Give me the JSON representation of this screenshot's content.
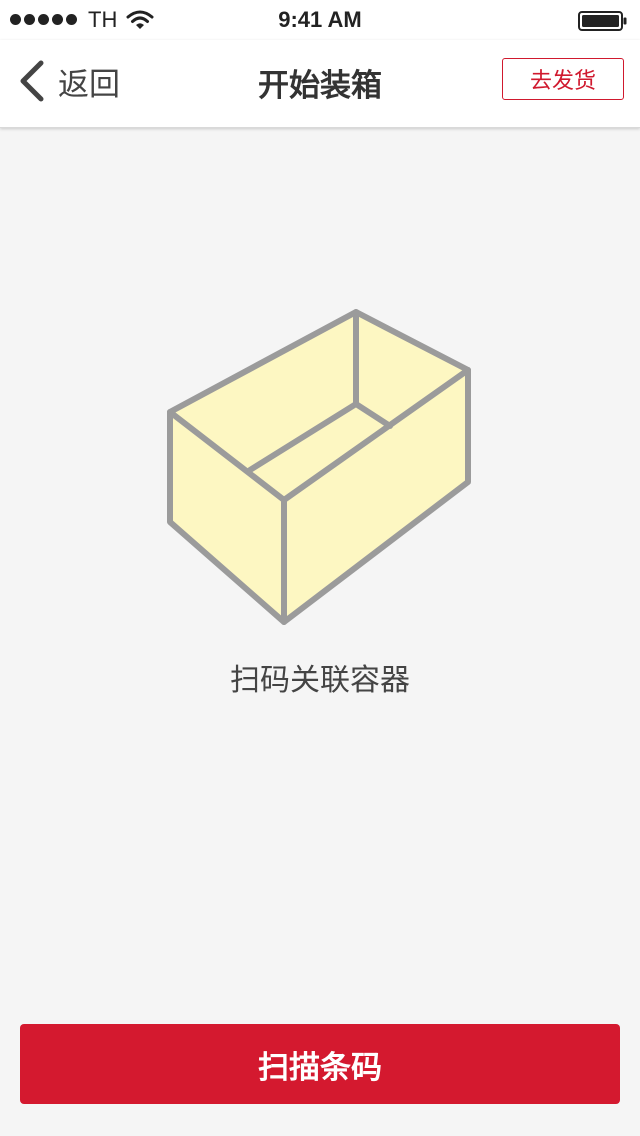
{
  "status_bar": {
    "carrier": "TH",
    "time": "9:41 AM",
    "signal_icon": "signal-dots-icon",
    "wifi_icon": "wifi-icon",
    "battery_icon": "battery-icon"
  },
  "nav": {
    "back_icon": "chevron-left-icon",
    "back_label": "返回",
    "title": "开始装箱",
    "action_label": "去发货"
  },
  "content": {
    "illustration_icon": "box-icon",
    "hint": "扫码关联容器"
  },
  "footer": {
    "scan_label": "扫描条码"
  },
  "colors": {
    "accent": "#d4192f",
    "box_fill": "#fdf7c2",
    "box_stroke": "#9b9b9b",
    "background": "#f5f5f5"
  }
}
